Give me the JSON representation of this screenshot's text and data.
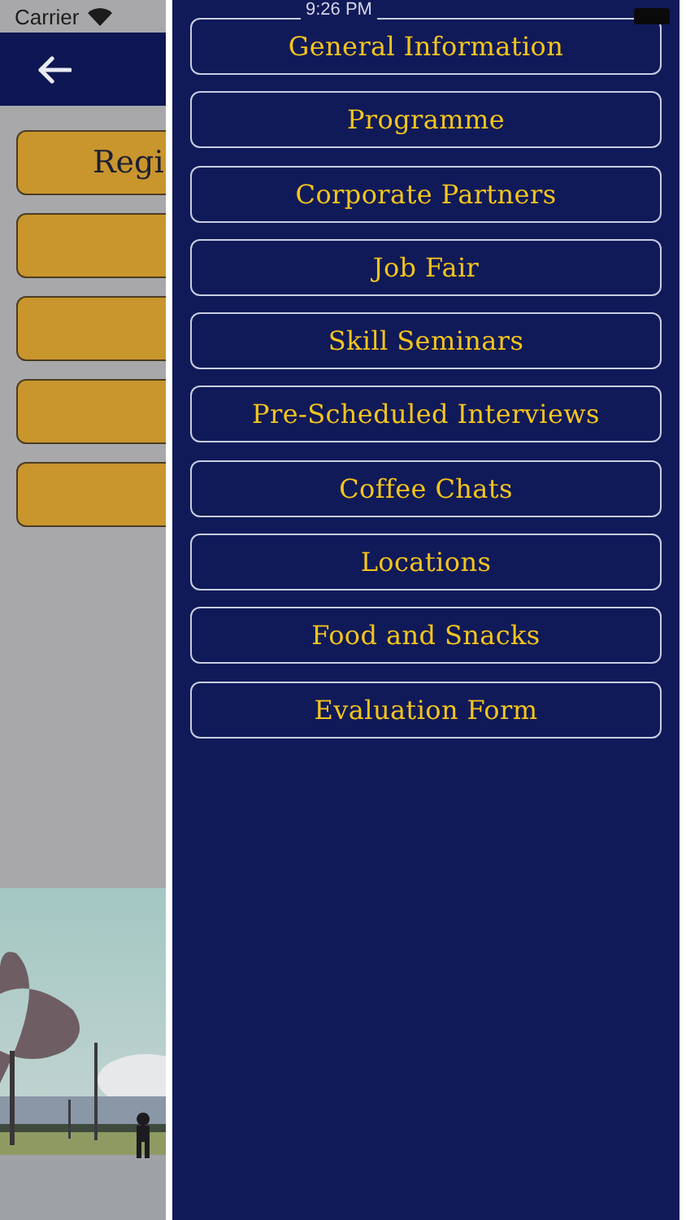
{
  "status_bar": {
    "carrier": "Carrier",
    "time": "9:26 PM"
  },
  "background_page": {
    "buttons": [
      {
        "kind": "labeled",
        "label": "Regi"
      },
      {
        "kind": "blank"
      },
      {
        "kind": "blank"
      },
      {
        "kind": "blank"
      },
      {
        "kind": "blank"
      }
    ]
  },
  "drawer": {
    "items": [
      {
        "label": "General Information"
      },
      {
        "label": "Programme"
      },
      {
        "label": "Corporate Partners"
      },
      {
        "label": "Job Fair"
      },
      {
        "label": "Skill Seminars"
      },
      {
        "label": "Pre-Scheduled Interviews"
      },
      {
        "label": "Coffee Chats"
      },
      {
        "label": "Locations"
      },
      {
        "label": "Food and Snacks"
      },
      {
        "label": "Evaluation Form"
      }
    ]
  }
}
